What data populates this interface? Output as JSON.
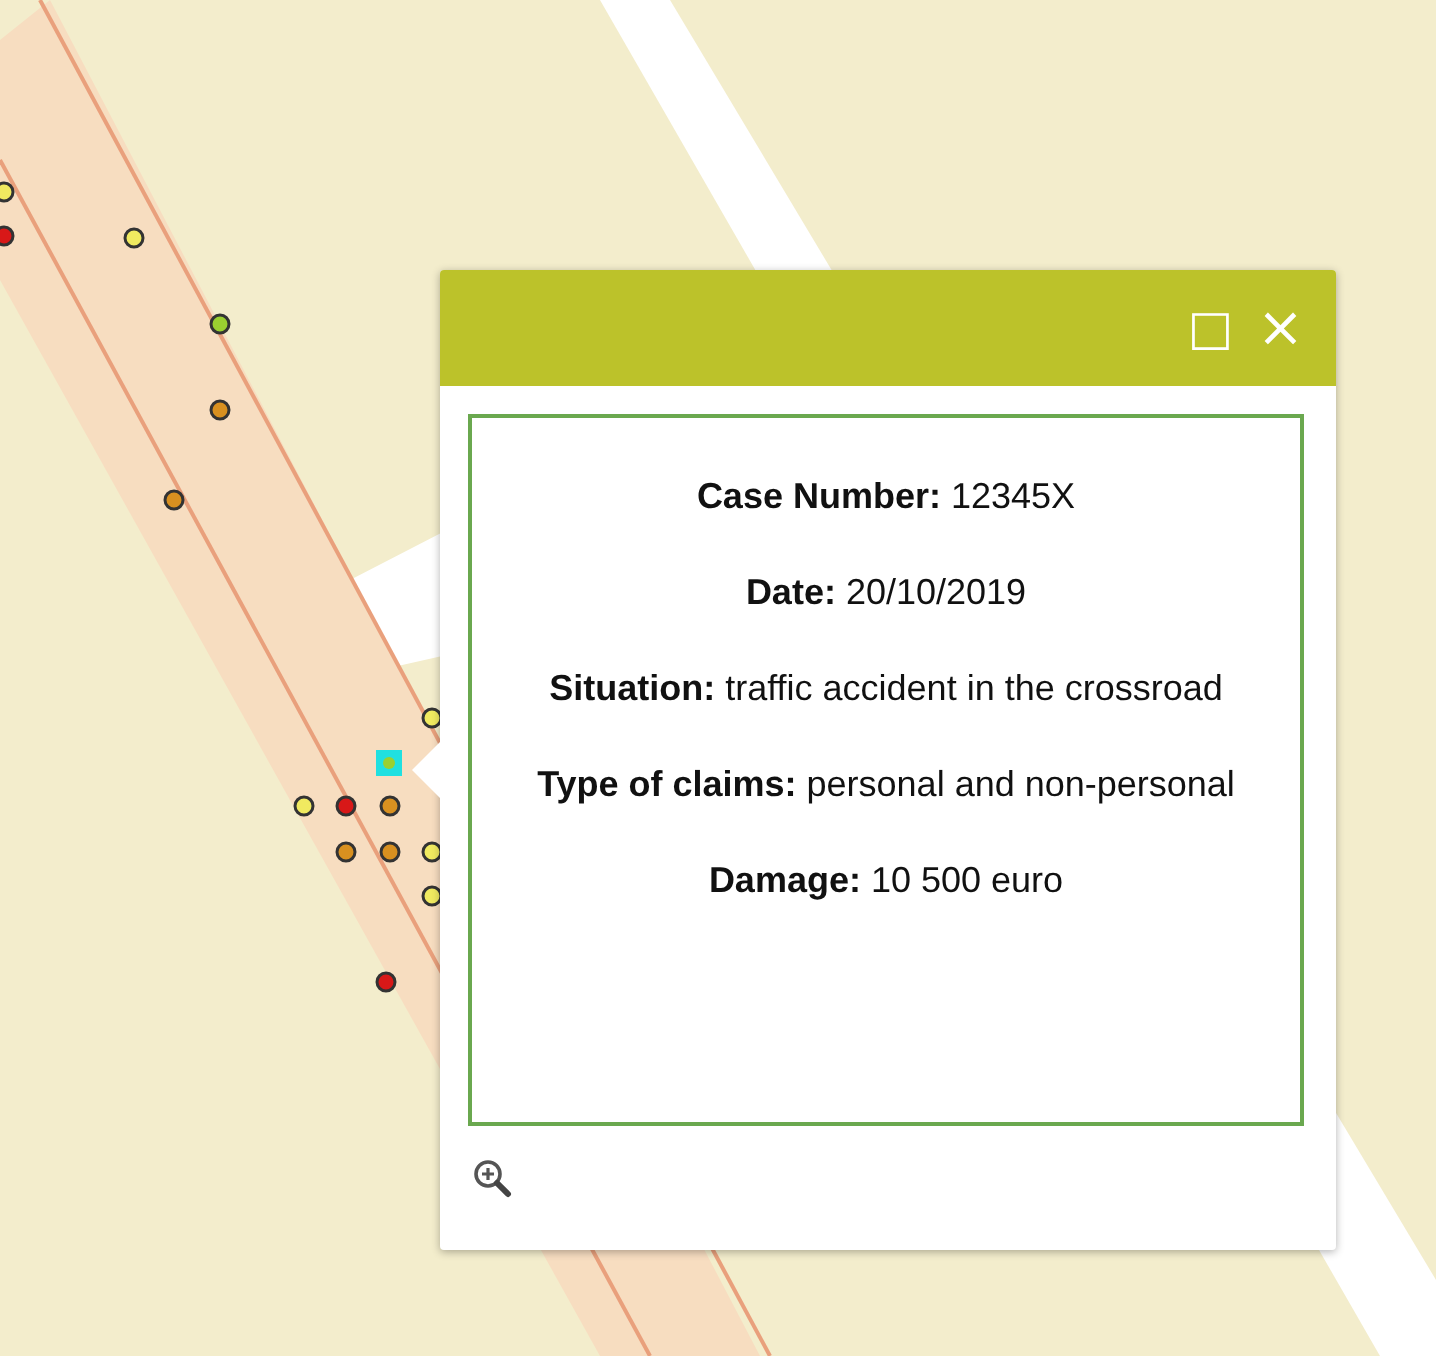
{
  "popup": {
    "header": {
      "maximize_icon": "□",
      "close_icon": "×"
    },
    "fields": [
      {
        "label": "Case Number:",
        "value": "12345X"
      },
      {
        "label": "Date:",
        "value": "20/10/2019"
      },
      {
        "label": "Situation:",
        "value": "traffic accident in the crossroad"
      },
      {
        "label": "Type of claims:",
        "value": "personal and non-personal"
      },
      {
        "label": "Damage:",
        "value": "10 500  euro"
      }
    ]
  }
}
